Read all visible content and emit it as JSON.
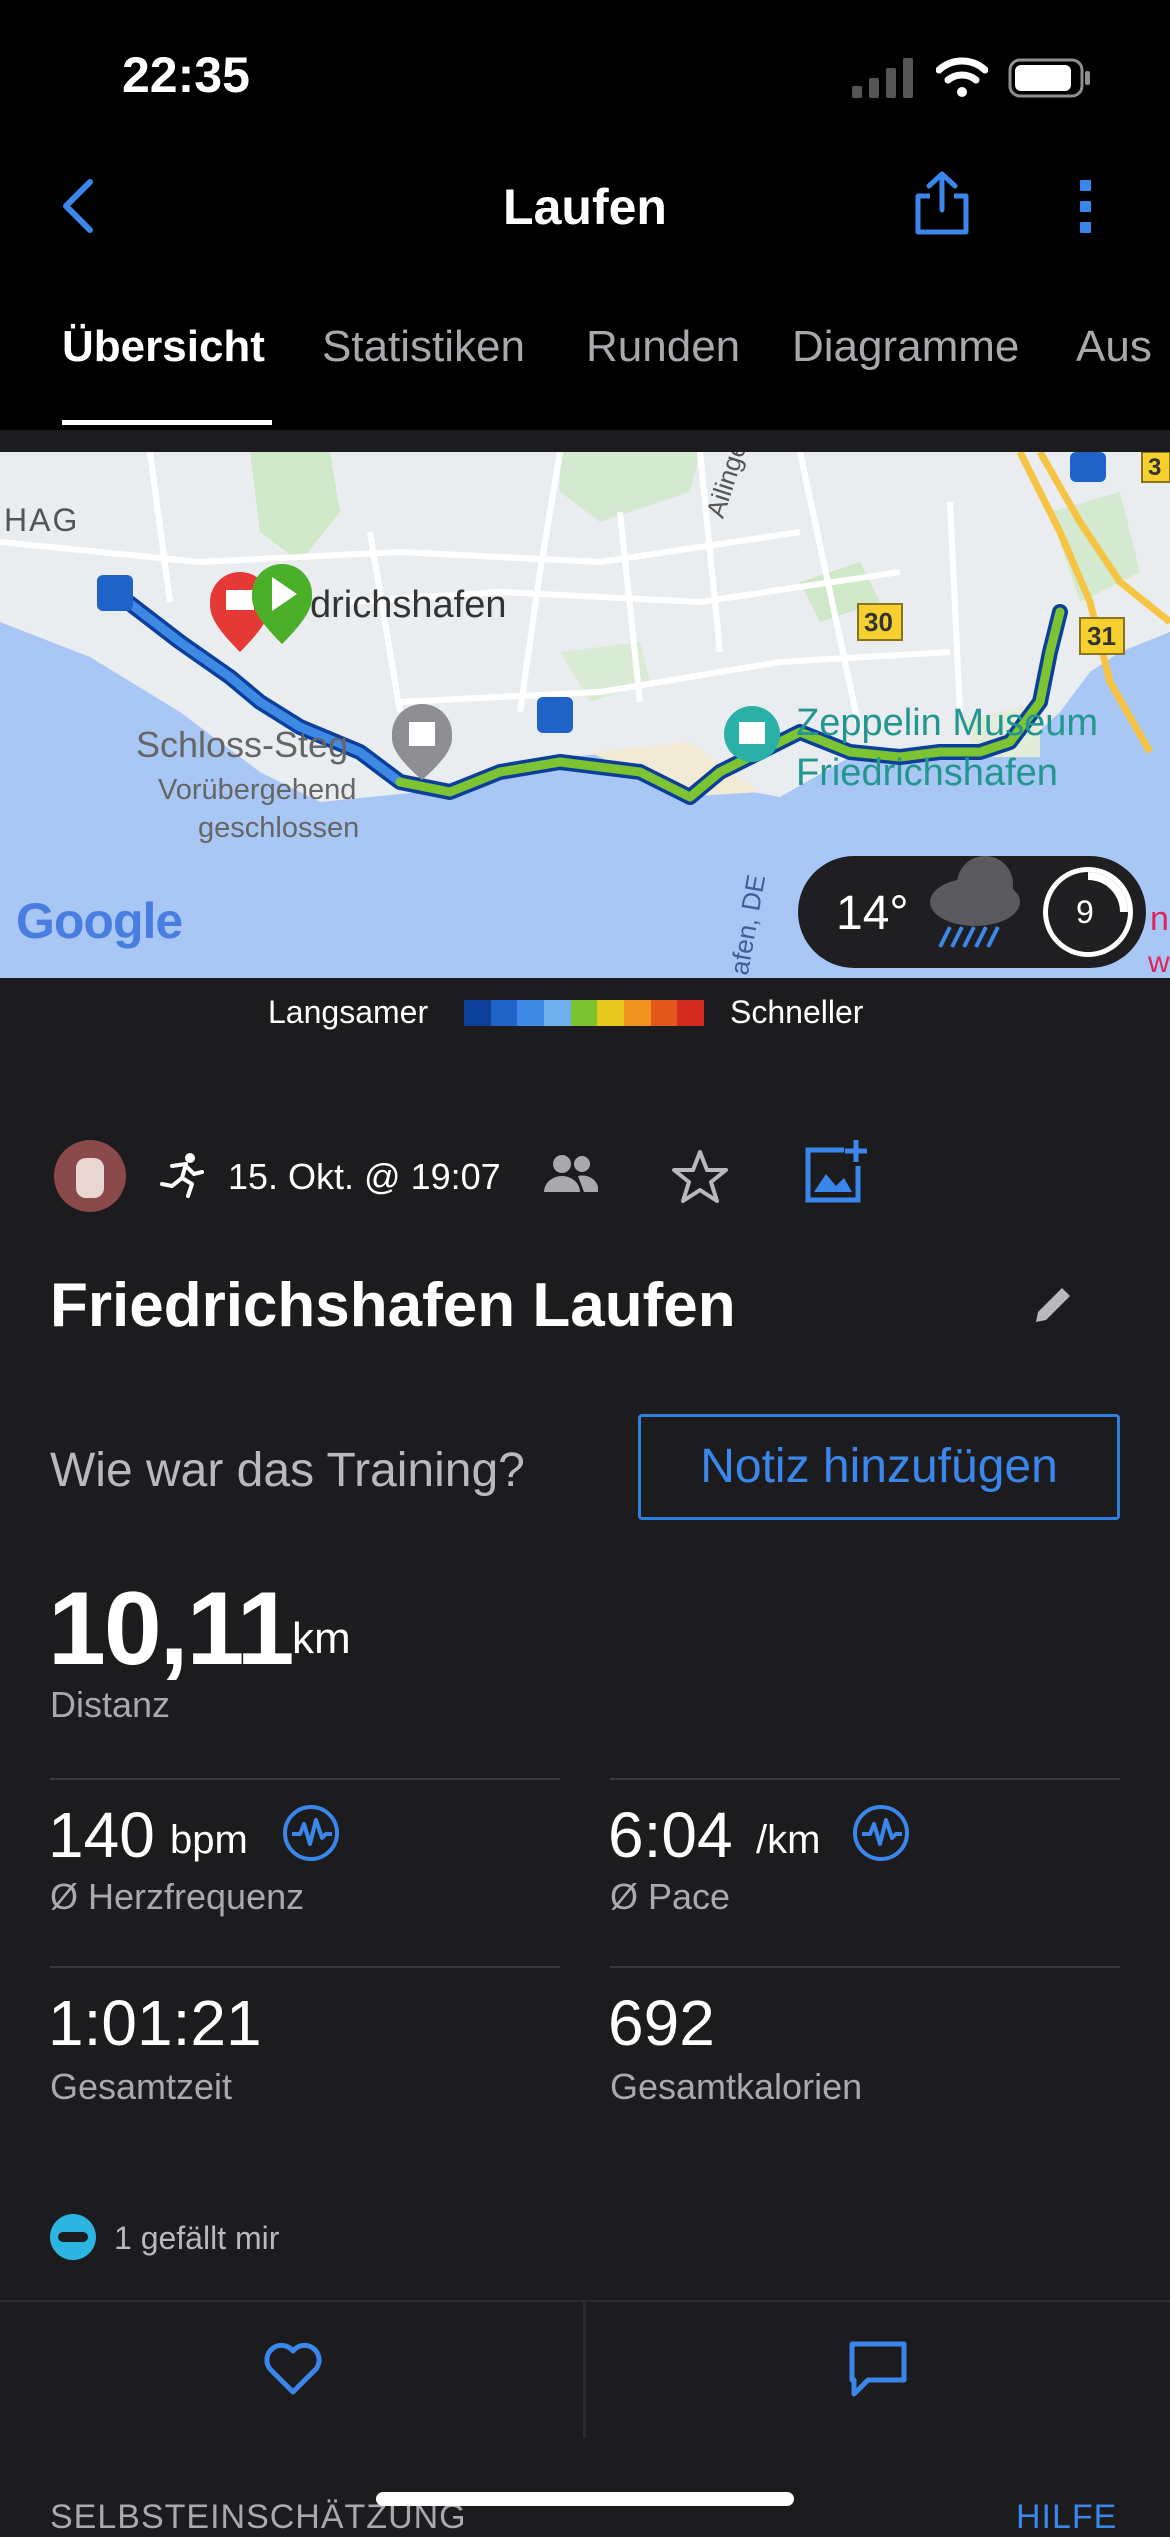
{
  "status": {
    "time": "22:35"
  },
  "header": {
    "title": "Laufen"
  },
  "tabs": [
    {
      "label": "Übersicht"
    },
    {
      "label": "Statistiken"
    },
    {
      "label": "Runden"
    },
    {
      "label": "Diagramme"
    },
    {
      "label": "Aus"
    }
  ],
  "map": {
    "labels": {
      "hag": "HAG",
      "city": "drichshafen",
      "street": "Ailinger St",
      "road30": "30",
      "road31": "31",
      "road3": "3",
      "museum1": "Zeppelin Museum",
      "museum2": "Friedrichshafen",
      "castle1": "Schloss-Steg",
      "castle2": "Vorübergehend",
      "castle3": "geschlossen",
      "harbor": "afen, DE",
      "edge1": "n",
      "edge2": "wiese"
    },
    "google": "Google",
    "weather": {
      "temp": "14°",
      "wind": "9"
    }
  },
  "legend": {
    "slower": "Langsamer",
    "faster": "Schneller",
    "colors": [
      "#0b3f9a",
      "#1f63c9",
      "#3d89e3",
      "#6fb0ef",
      "#7dc432",
      "#e6c81f",
      "#f0931e",
      "#e4561c",
      "#d42a22"
    ]
  },
  "activity": {
    "date": "15. Okt. @ 19:07",
    "name": "Friedrichshafen Laufen",
    "question": "Wie war das Training?",
    "note_button": "Notiz hinzufügen"
  },
  "stats": {
    "distance": {
      "value": "10,11",
      "unit": "km",
      "label": "Distanz"
    },
    "heart_rate": {
      "value": "140",
      "unit": "bpm",
      "label": "Ø Herzfrequenz"
    },
    "pace": {
      "value": "6:04",
      "unit": "/km",
      "label": "Ø Pace"
    },
    "total_time": {
      "value": "1:01:21",
      "label": "Gesamtzeit"
    },
    "calories": {
      "value": "692",
      "label": "Gesamtkalorien"
    }
  },
  "social": {
    "likes": "1 gefällt mir"
  },
  "footer": {
    "left": "SELBSTEINSCHÄTZUNG",
    "right": "HILFE"
  },
  "colors": {
    "accent": "#3a86ea",
    "background": "#1c1c1e",
    "bar": "#000000"
  }
}
